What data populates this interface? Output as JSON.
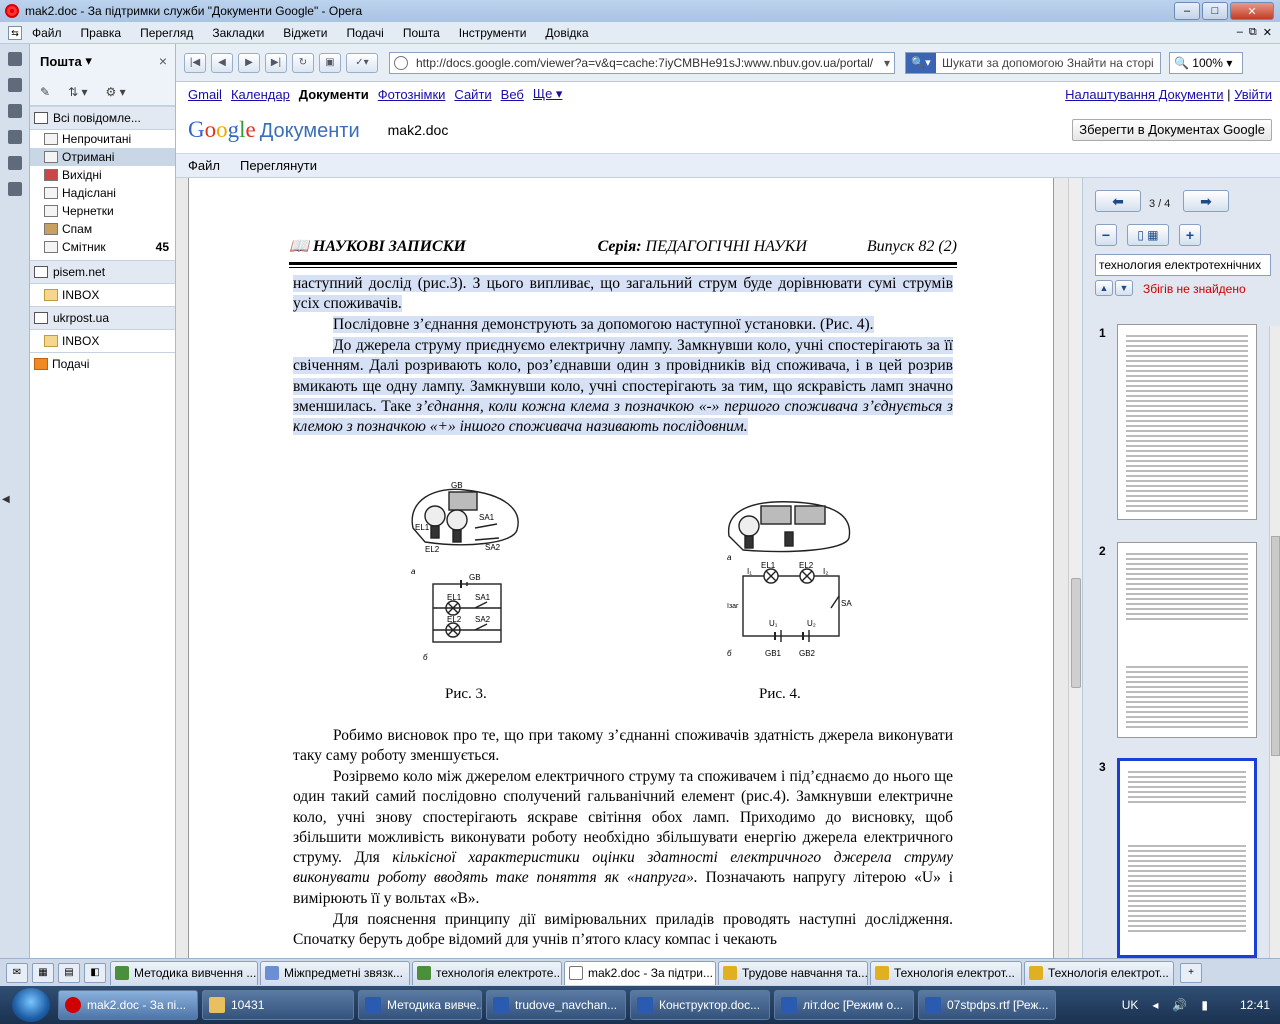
{
  "window": {
    "title": "mak2.doc - За підтримки служби \"Документи Google\" - Opera",
    "min": "–",
    "max": "□",
    "close": "✕"
  },
  "menubar": {
    "items": [
      "Файл",
      "Правка",
      "Перегляд",
      "Закладки",
      "Віджети",
      "Подачі",
      "Пошта",
      "Інструменти",
      "Довідка"
    ],
    "right": [
      "–",
      "⧉",
      "✕"
    ]
  },
  "mail": {
    "title": "Пошта",
    "close": "×",
    "all_messages": "Всі повідомле...",
    "folders": [
      {
        "label": "Непрочитані",
        "count": ""
      },
      {
        "label": "Отримані",
        "count": ""
      },
      {
        "label": "Вихідні",
        "count": ""
      },
      {
        "label": "Надіслані",
        "count": ""
      },
      {
        "label": "Чернетки",
        "count": ""
      },
      {
        "label": "Спам",
        "count": ""
      },
      {
        "label": "Смітник",
        "count": "45"
      }
    ],
    "accounts": [
      {
        "label": "pisem.net",
        "inbox": "INBOX"
      },
      {
        "label": "ukrpost.ua",
        "inbox": "INBOX"
      }
    ],
    "feeds": "Подачі"
  },
  "browser": {
    "url": "http://docs.google.com/viewer?a=v&q=cache:7iyCMBHe91sJ:www.nbuv.gov.ua/portal/",
    "search_placeholder": "Шукати за допомогою Знайти на сторі",
    "zoom": "100%"
  },
  "google": {
    "links": [
      "Gmail",
      "Календар"
    ],
    "current": "Документи",
    "links2": [
      "Фотознімки",
      "Сайти",
      "Веб",
      "Ще ▾"
    ],
    "settings": "Налаштування Документи",
    "separator": "|",
    "logout": "Увійти",
    "logo_docs": "Документи",
    "filename": "mak2.doc",
    "save_button": "Зберегти в Документах Google",
    "menu": [
      "Файл",
      "Переглянути"
    ]
  },
  "document": {
    "running_head_left": "НАУКОВІ ЗАПИСКИ",
    "running_head_series": "Серія:",
    "running_head_series_name": "ПЕДАГОГІЧНІ НАУКИ",
    "running_head_right": "Випуск 82 (2)",
    "p1": "наступний дослід (рис.3). З цього випливає, що загальний струм буде дорівнювати сумі струмів усіх споживачів.",
    "p2": "Послідовне з’єднання демонструють за допомогою наступної установки. (Рис. 4).",
    "p3a": "До джерела струму приєднуємо електричну лампу. Замкнувши коло, учні спостерігають за її свіченням. Далі розривають коло, роз’єднавши один з провідників від споживача, і в цей розрив вмикають ще одну лампу. Замкнувши коло, учні спостерігають за тим, що яскравість ламп значно зменшилась. Таке ",
    "p3b": "з’єднання, коли кожна клема з позначкою «-» першого споживача з’єднується з клемою з позначкою «+» іншого споживача називають послідовним.",
    "fig3_caption": "Рис. 3.",
    "fig4_caption": "Рис. 4.",
    "p4": "Робимо висновок про те, що при такому з’єднанні споживачів здатність джерела виконувати таку саму роботу зменшується.",
    "p5a": "Розірвемо коло між джерелом електричного струму та споживачем і під’єднаємо до нього ще один такий самий послідовно сполучений гальванічний елемент (рис.4). Замкнувши електричне коло, учні знову спостерігають яскраве світіння обох ламп. Приходимо до висновку, щоб збільшити можливість виконувати роботу необхідно збільшувати енергію джерела електричного струму. Для ",
    "p5b": "кількісної характеристики оцінки здатності електричного джерела струму виконувати роботу вводять таке поняття як «напруга».",
    "p5c": " Позначають напругу літерою «U» і вимірюють її у вольтах «В».",
    "p6": "Для пояснення принципу дії вимірювальних приладів проводять наступні дослідження. Спочатку беруть добре відомий для учнів п’ятого класу компас і чекають",
    "fig3_labels": {
      "gb": "GB",
      "el1": "EL1",
      "el2": "EL2",
      "sa1": "SA1",
      "sa2": "SA2",
      "a": "а",
      "b": "б"
    },
    "fig4_labels": {
      "el1": "EL1",
      "el2": "EL2",
      "i1": "I₁",
      "i2": "I₂",
      "isum": "Iзаг",
      "u1": "U₁",
      "u2": "U₂",
      "gb1": "GB1",
      "gb2": "GB2",
      "sa": "SA",
      "a": "а",
      "b": "б"
    }
  },
  "sidebar": {
    "page_indicator": "3 / 4",
    "search_value": "технология електротехнічних",
    "not_found": "Збігів не знайдено",
    "thumbs": [
      "1",
      "2",
      "3"
    ]
  },
  "tabs": [
    {
      "label": "Методика вивчення ...",
      "color": "#4a8f3c"
    },
    {
      "label": "Міжпредметні звязк...",
      "color": "#6b8fd0"
    },
    {
      "label": "технологія електроте...",
      "color": "#4a8f3c"
    },
    {
      "label": "mak2.doc - За підтри...",
      "color": "#ffffff"
    },
    {
      "label": "Трудове навчання та...",
      "color": "#e0b020"
    },
    {
      "label": "Технологія електрот...",
      "color": "#e0b020"
    },
    {
      "label": "Технологія електрот...",
      "color": "#e0b020"
    }
  ],
  "tab_add": "+",
  "taskbar": {
    "tasks": [
      {
        "label": "mak2.doc - За пі...",
        "color": "#d00000"
      },
      {
        "label": "10431",
        "color": "#e8c060"
      },
      {
        "label": "Методика вивче...",
        "color": "#2a5bb0"
      },
      {
        "label": "trudove_navchan...",
        "color": "#2a5bb0"
      },
      {
        "label": "Конструктор.doc...",
        "color": "#2a5bb0"
      },
      {
        "label": "літ.doc [Режим о...",
        "color": "#2a5bb0"
      },
      {
        "label": "07stpdps.rtf [Реж...",
        "color": "#2a5bb0"
      }
    ],
    "lang": "UK",
    "clock": "12:41"
  }
}
